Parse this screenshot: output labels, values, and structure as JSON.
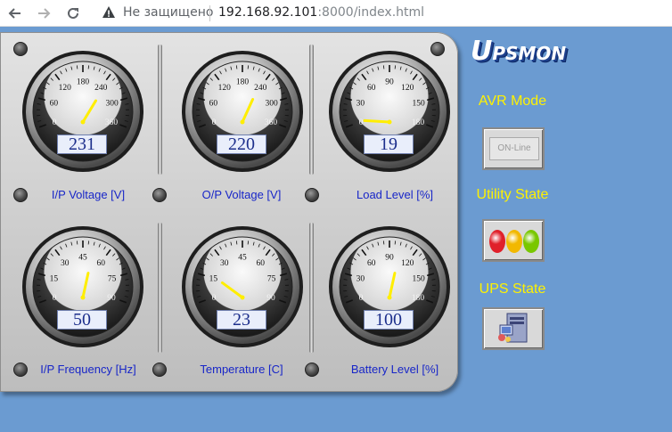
{
  "browser": {
    "security_text": "Не защищено",
    "url_host": "192.168.92.101",
    "url_rest": ":8000/index.html"
  },
  "logo": {
    "text_big_u": "U",
    "text_ps": "PS",
    "text_mon": "MON"
  },
  "gauges": [
    {
      "label": "I/P Voltage [V]",
      "value": "231",
      "min": 0,
      "max": 360,
      "ticks": [
        "0",
        "60",
        "120",
        "180",
        "240",
        "300",
        "360"
      ],
      "reading": 231
    },
    {
      "label": "O/P Voltage [V]",
      "value": "220",
      "min": 0,
      "max": 360,
      "ticks": [
        "0",
        "60",
        "120",
        "180",
        "240",
        "300",
        "360"
      ],
      "reading": 220
    },
    {
      "label": "Load Level [%]",
      "value": "19",
      "min": 0,
      "max": 180,
      "ticks": [
        "0",
        "30",
        "60",
        "90",
        "120",
        "150",
        "180"
      ],
      "reading": 19
    },
    {
      "label": "I/P Frequency [Hz]",
      "value": "50",
      "min": 0,
      "max": 90,
      "ticks": [
        "0",
        "15",
        "30",
        "45",
        "60",
        "75",
        "90"
      ],
      "reading": 50
    },
    {
      "label": "Temperature [C]",
      "value": "23",
      "min": 0,
      "max": 90,
      "ticks": [
        "0",
        "15",
        "30",
        "45",
        "60",
        "75",
        "90"
      ],
      "reading": 23
    },
    {
      "label": "Battery Level [%]",
      "value": "100",
      "min": 0,
      "max": 180,
      "ticks": [
        "0",
        "30",
        "60",
        "90",
        "120",
        "150",
        "180"
      ],
      "reading": 100
    }
  ],
  "avr": {
    "title": "AVR Mode",
    "button_label": "ON-Line"
  },
  "utility": {
    "title": "Utility State",
    "lamp_colors": [
      "#e0202a",
      "#f2b800",
      "#79c700"
    ]
  },
  "ups_state": {
    "title": "UPS State",
    "icon": "computer-icon"
  },
  "colors": {
    "background": "#6b9bd1",
    "label_blue": "#1826c8",
    "side_yellow": "#fff200",
    "needle": "#ffee00"
  }
}
